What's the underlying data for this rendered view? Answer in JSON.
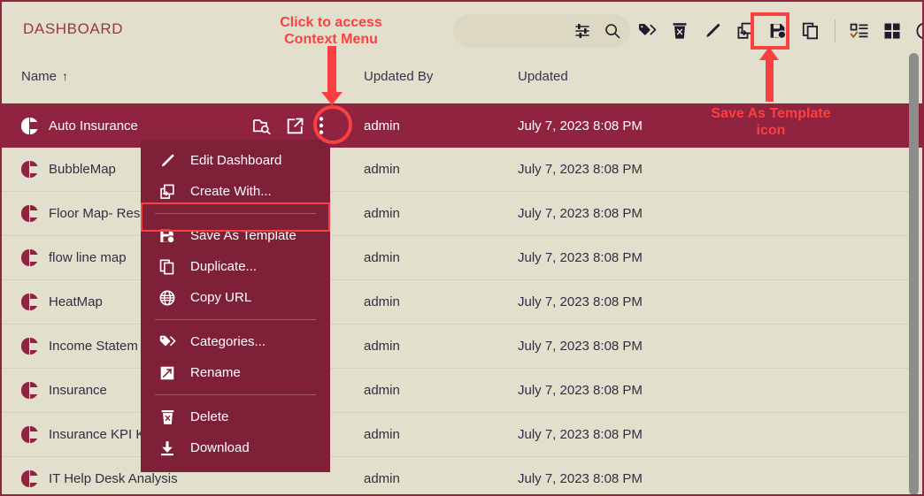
{
  "header": {
    "title": "DASHBOARD",
    "search": {
      "placeholder": "",
      "value": ""
    },
    "search_icons": [
      {
        "name": "filter-settings-icon",
        "label": "Filter Settings"
      },
      {
        "name": "search-icon",
        "label": "Search"
      }
    ],
    "toolbar": [
      {
        "name": "tag-icon",
        "label": "Categories"
      },
      {
        "name": "delete-icon",
        "label": "Delete"
      },
      {
        "name": "edit-icon",
        "label": "Edit"
      },
      {
        "name": "create-with-icon",
        "label": "Create With"
      },
      {
        "name": "save-as-template-icon",
        "label": "Save As Template"
      },
      {
        "name": "duplicate-icon",
        "label": "Duplicate"
      },
      {
        "name": "checklist-icon",
        "label": "Select Items"
      },
      {
        "name": "grid-view-icon",
        "label": "Grid View"
      },
      {
        "name": "info-icon",
        "label": "Info"
      }
    ]
  },
  "columns": {
    "name": "Name",
    "sort_indicator": "↑",
    "updated_by": "Updated By",
    "updated": "Updated"
  },
  "rows": [
    {
      "name": "Auto Insurance",
      "updated_by": "admin",
      "updated": "July 7, 2023 8:08 PM",
      "selected": true
    },
    {
      "name": "BubbleMap",
      "updated_by": "admin",
      "updated": "July 7, 2023 8:08 PM",
      "selected": false
    },
    {
      "name": "Floor Map- Res",
      "updated_by": "admin",
      "updated": "July 7, 2023 8:08 PM",
      "selected": false
    },
    {
      "name": "flow line map",
      "updated_by": "admin",
      "updated": "July 7, 2023 8:08 PM",
      "selected": false
    },
    {
      "name": "HeatMap",
      "updated_by": "admin",
      "updated": "July 7, 2023 8:08 PM",
      "selected": false
    },
    {
      "name": "Income Statem",
      "updated_by": "admin",
      "updated": "July 7, 2023 8:08 PM",
      "selected": false
    },
    {
      "name": "Insurance",
      "updated_by": "admin",
      "updated": "July 7, 2023 8:08 PM",
      "selected": false
    },
    {
      "name": "Insurance KPI Kanban",
      "updated_by": "admin",
      "updated": "July 7, 2023 8:08 PM",
      "selected": false
    },
    {
      "name": "IT Help Desk Analysis",
      "updated_by": "admin",
      "updated": "July 7, 2023 8:08 PM",
      "selected": false
    }
  ],
  "row_actions": [
    {
      "name": "folder-search-icon",
      "label": "Find in Folder"
    },
    {
      "name": "open-external-icon",
      "label": "Open"
    },
    {
      "name": "more-options-icon",
      "label": "More Options"
    }
  ],
  "context_menu": {
    "items": [
      {
        "label": "Edit Dashboard",
        "icon": "edit-icon"
      },
      {
        "label": "Create With...",
        "icon": "create-with-icon"
      },
      {
        "label": "Save As Template",
        "icon": "save-as-template-icon",
        "highlighted": true
      },
      {
        "label": "Duplicate...",
        "icon": "duplicate-icon"
      },
      {
        "label": "Copy URL",
        "icon": "globe-icon"
      },
      {
        "label": "Categories...",
        "icon": "tag-icon"
      },
      {
        "label": "Rename",
        "icon": "rename-icon"
      },
      {
        "label": "Delete",
        "icon": "delete-icon"
      },
      {
        "label": "Download",
        "icon": "download-icon"
      }
    ]
  },
  "annotations": {
    "click_context_line1": "Click to access",
    "click_context_line2": "Context Menu",
    "save_template_line1": "Save As Template",
    "save_template_line2": "icon"
  },
  "colors": {
    "background": "#e3dfcd",
    "accent": "#8f2340",
    "menu_background": "#7e2038",
    "annotation": "#fa4040",
    "border": "#8f2340"
  }
}
